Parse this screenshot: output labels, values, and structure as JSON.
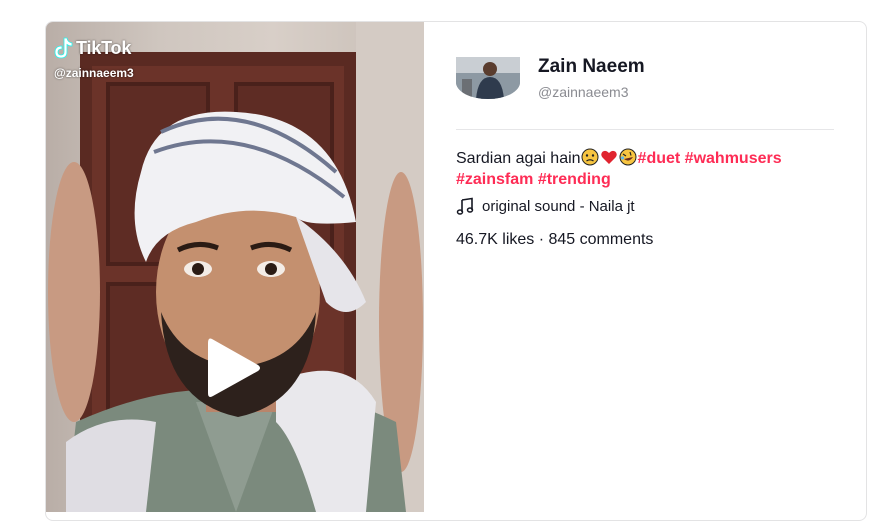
{
  "video": {
    "watermark_brand": "TikTok",
    "watermark_handle": "@zainnaeem3"
  },
  "author": {
    "name": "Zain Naeem",
    "handle": "@zainnaeem3"
  },
  "caption": {
    "text": "Sardian agai hain",
    "emojis": [
      "sad-face-emoji",
      "red-heart-emoji",
      "rolling-laughing-emoji"
    ],
    "hashtags": [
      "#duet",
      "#wahmusers",
      "#zainsfam",
      "#trending"
    ]
  },
  "sound": {
    "label": "original sound - Naila jt",
    "icon": "music-note-icon"
  },
  "stats": {
    "text": "46.7K likes · 845 comments"
  },
  "colors": {
    "hashtag": "#fe2c55",
    "text": "#161823",
    "muted": "#8a8b91"
  }
}
